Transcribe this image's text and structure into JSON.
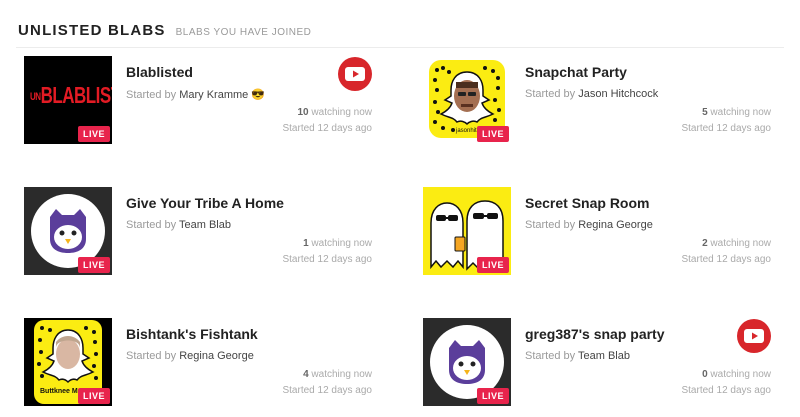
{
  "header": {
    "title": "UNLISTED BLABS",
    "subtitle": "BLABS YOU HAVE JOINED"
  },
  "colors": {
    "live": "#e8244c",
    "youtube": "#d8262b",
    "snap_yellow": "#fbec12",
    "owl_purple": "#5b3e9b"
  },
  "cards": [
    {
      "title": "Blablisted",
      "started_by_label": "Started by",
      "starter": "Mary Kramme 😎",
      "watching_count": "10",
      "watching_label": "watching now",
      "started_ago": "Started 12 days ago",
      "live_label": "LIVE",
      "thumb_text": "BLABLIST",
      "thumb_text_prefix": "UN",
      "icon": "youtube-icon"
    },
    {
      "title": "Snapchat Party",
      "started_by_label": "Started by",
      "starter": "Jason Hitchcock",
      "watching_count": "5",
      "watching_label": "watching now",
      "started_ago": "Started 12 days ago",
      "live_label": "LIVE",
      "thumb_caption": "jasonhitch",
      "icon": "snapcode-icon"
    },
    {
      "title": "Give Your Tribe A Home",
      "started_by_label": "Started by",
      "starter": "Team Blab",
      "watching_count": "1",
      "watching_label": "watching now",
      "started_ago": "Started 12 days ago",
      "live_label": "LIVE",
      "icon": "blab-owl-icon"
    },
    {
      "title": "Secret Snap Room",
      "started_by_label": "Started by",
      "starter": "Regina George",
      "watching_count": "2",
      "watching_label": "watching now",
      "started_ago": "Started 12 days ago",
      "live_label": "LIVE",
      "icon": "ghosts-icon"
    },
    {
      "title": "Bishtank's Fishtank",
      "started_by_label": "Started by",
      "starter": "Regina George",
      "watching_count": "4",
      "watching_label": "watching now",
      "started_ago": "Started 12 days ago",
      "live_label": "LIVE",
      "thumb_caption": "Buttknee Me",
      "icon": "snapcode-icon"
    },
    {
      "title": "greg387's snap party",
      "started_by_label": "Started by",
      "starter": "Team Blab",
      "watching_count": "0",
      "watching_label": "watching now",
      "started_ago": "Started 12 days ago",
      "live_label": "LIVE",
      "icon": "youtube-icon"
    }
  ]
}
